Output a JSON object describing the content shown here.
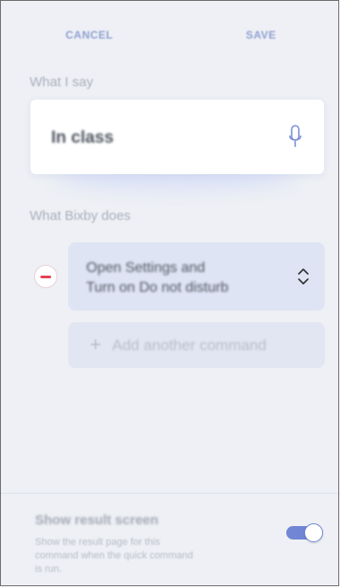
{
  "header": {
    "cancel_label": "CANCEL",
    "save_label": "SAVE"
  },
  "what_i_say": {
    "label": "What I say",
    "value": "In class",
    "icon": "microphone-icon"
  },
  "what_bixby_does": {
    "label": "What Bixby does",
    "commands": [
      {
        "lines": [
          "Open Settings and",
          "Turn on Do not disturb"
        ],
        "icon": "reorder-icon"
      }
    ],
    "remove_icon": "remove-icon",
    "add_label": "Add another command",
    "add_icon": "plus-icon"
  },
  "result_screen": {
    "title": "Show result screen",
    "description_lines": [
      "Show the result page for this",
      "command when the quick command",
      "is run."
    ],
    "toggle_on": true
  },
  "colors": {
    "background": "#eef0f5",
    "accent": "#7186d4",
    "danger": "#e64257",
    "card": "#dfe4f4"
  }
}
